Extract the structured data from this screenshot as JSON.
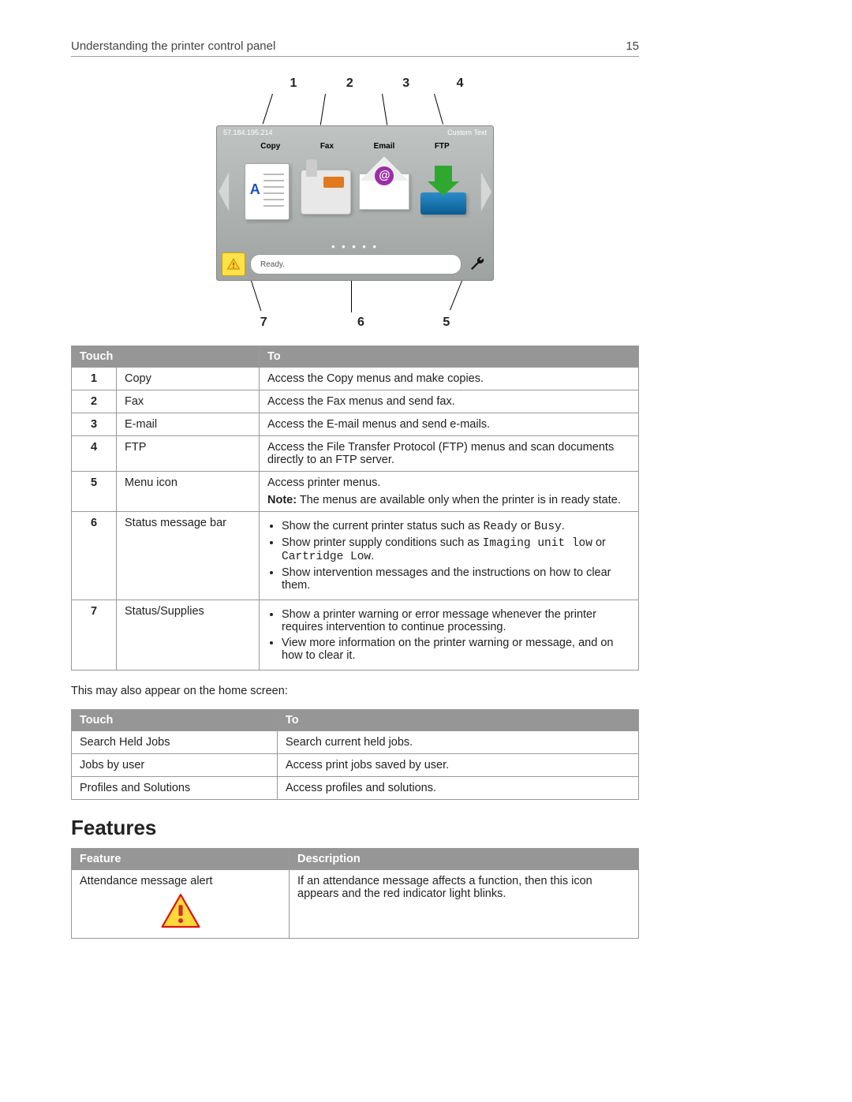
{
  "header": {
    "title": "Understanding the printer control panel",
    "page": "15"
  },
  "figure": {
    "top_callouts": [
      "1",
      "2",
      "3",
      "4"
    ],
    "bottom_callouts": [
      "7",
      "6",
      "5"
    ],
    "ip": "57.184.195.214",
    "custom_text": "Custom Text",
    "app_labels": {
      "copy": "Copy",
      "fax": "Fax",
      "email": "Email",
      "ftp": "FTP"
    },
    "status_text": "Ready."
  },
  "table1": {
    "headers": {
      "touch": "Touch",
      "to": "To"
    },
    "rows": [
      {
        "n": "1",
        "name": "Copy",
        "to": "Access the Copy menus and make copies."
      },
      {
        "n": "2",
        "name": "Fax",
        "to": "Access the Fax menus and send fax."
      },
      {
        "n": "3",
        "name": "E-mail",
        "to": "Access the E-mail menus and send e-mails."
      },
      {
        "n": "4",
        "name": "FTP",
        "to": "Access the File Transfer Protocol (FTP) menus and scan documents directly to an FTP server."
      }
    ],
    "row5": {
      "n": "5",
      "name": "Menu icon",
      "line1": "Access printer menus.",
      "note_label": "Note:",
      "note_rest": " The menus are available only when the printer is in ready state."
    },
    "row6": {
      "n": "6",
      "name": "Status message bar",
      "b1a": "Show the current printer status such as ",
      "b1_code1": "Ready",
      "b1_mid": " or ",
      "b1_code2": "Busy",
      "b1_end": ".",
      "b2a": "Show printer supply conditions such as ",
      "b2_code1": "Imaging unit low",
      "b2_mid": " or ",
      "b2_code2": "Cartridge Low",
      "b2_end": ".",
      "b3": "Show intervention messages and the instructions on how to clear them."
    },
    "row7": {
      "n": "7",
      "name": "Status/Supplies",
      "b1": "Show a printer warning or error message whenever the printer requires intervention to continue processing.",
      "b2": "View more information on the printer warning or message, and on how to clear it."
    }
  },
  "intro2": "This may also appear on the home screen:",
  "table2": {
    "headers": {
      "touch": "Touch",
      "to": "To"
    },
    "rows": [
      {
        "name": "Search Held Jobs",
        "to": "Search current held jobs."
      },
      {
        "name": "Jobs by user",
        "to": "Access print jobs saved by user."
      },
      {
        "name": "Profiles and Solutions",
        "to": "Access profiles and solutions."
      }
    ]
  },
  "features": {
    "heading": "Features",
    "headers": {
      "feature": "Feature",
      "description": "Description"
    },
    "row": {
      "name": "Attendance message alert",
      "desc": "If an attendance message affects a function, then this icon appears and the red indicator light blinks."
    }
  }
}
